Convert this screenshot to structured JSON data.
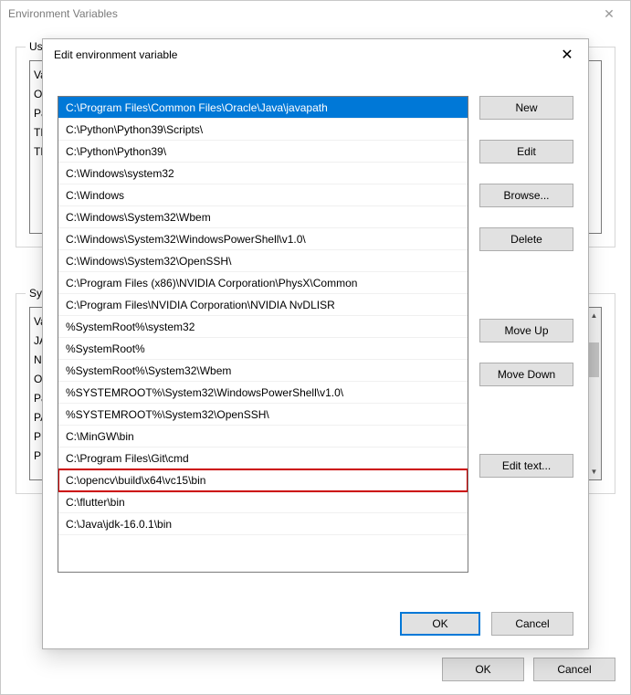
{
  "outer": {
    "title": "Environment Variables",
    "user_legend": "User",
    "sys_legend": "Syste",
    "user_col": "Va\nOr\nPa\nTE\nTN",
    "sys_col": "Va\nJA\nNU\nOS\nPa\nPA\nPR\nPR",
    "ok": "OK",
    "cancel": "Cancel"
  },
  "user_rows": [
    "Va",
    "Or",
    "Pa",
    "TE",
    "TN"
  ],
  "sys_rows": [
    "Va",
    "JA",
    "NU",
    "OS",
    "Pa",
    "PA",
    "PR",
    "PR"
  ],
  "dialog": {
    "title": "Edit environment variable",
    "ok": "OK",
    "cancel": "Cancel"
  },
  "buttons": {
    "new": "New",
    "edit": "Edit",
    "browse": "Browse...",
    "delete": "Delete",
    "moveup": "Move Up",
    "movedown": "Move Down",
    "edittext": "Edit text..."
  },
  "paths": [
    "C:\\Program Files\\Common Files\\Oracle\\Java\\javapath",
    "C:\\Python\\Python39\\Scripts\\",
    "C:\\Python\\Python39\\",
    "C:\\Windows\\system32",
    "C:\\Windows",
    "C:\\Windows\\System32\\Wbem",
    "C:\\Windows\\System32\\WindowsPowerShell\\v1.0\\",
    "C:\\Windows\\System32\\OpenSSH\\",
    "C:\\Program Files (x86)\\NVIDIA Corporation\\PhysX\\Common",
    "C:\\Program Files\\NVIDIA Corporation\\NVIDIA NvDLISR",
    "%SystemRoot%\\system32",
    "%SystemRoot%",
    "%SystemRoot%\\System32\\Wbem",
    "%SYSTEMROOT%\\System32\\WindowsPowerShell\\v1.0\\",
    "%SYSTEMROOT%\\System32\\OpenSSH\\",
    "C:\\MinGW\\bin",
    "C:\\Program Files\\Git\\cmd",
    "C:\\opencv\\build\\x64\\vc15\\bin",
    "C:\\flutter\\bin",
    "C:\\Java\\jdk-16.0.1\\bin"
  ],
  "selected_index": 0,
  "boxed_index": 17
}
